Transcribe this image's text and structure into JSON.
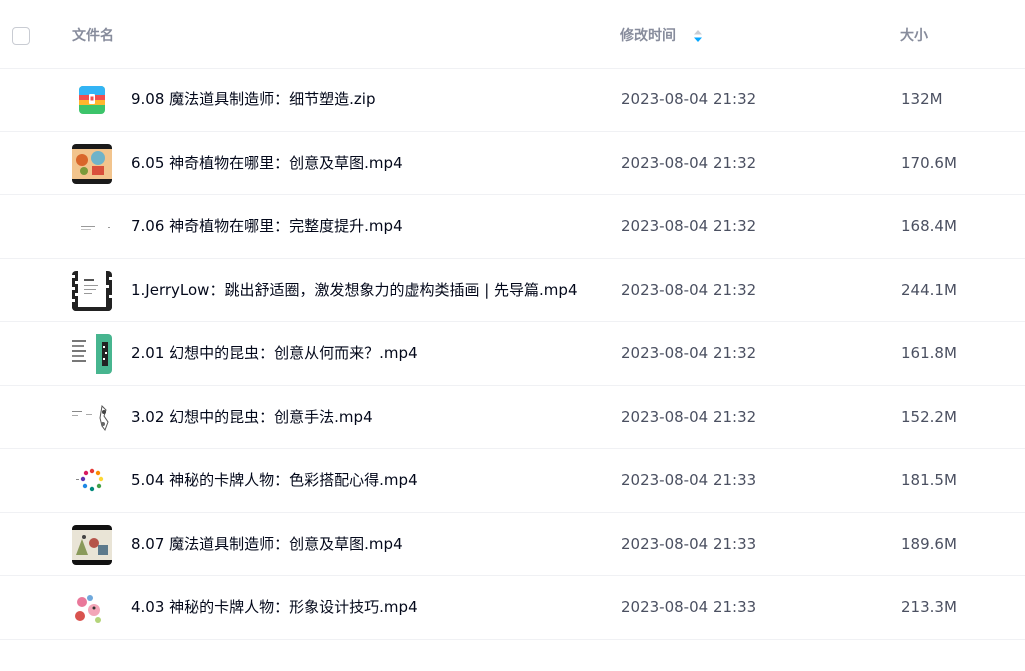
{
  "header": {
    "name_label": "文件名",
    "time_label": "修改时间",
    "size_label": "大小",
    "sort_icon": "sort-desc-icon",
    "sort_active_color": "#06a7ff"
  },
  "files": [
    {
      "name": "9.08 魔法道具制造师：细节塑造.zip",
      "time": "2023-08-04 21:32",
      "size": "132M",
      "icon": "zip-archive-icon"
    },
    {
      "name": "6.05 神奇植物在哪里：创意及草图.mp4",
      "time": "2023-08-04 21:32",
      "size": "170.6M",
      "icon": "video-thumbnail"
    },
    {
      "name": "7.06 神奇植物在哪里：完整度提升.mp4",
      "time": "2023-08-04 21:32",
      "size": "168.4M",
      "icon": "video-thumbnail"
    },
    {
      "name": "1.JerryLow：跳出舒适圈，激发想象力的虚构类插画 | 先导篇.mp4",
      "time": "2023-08-04 21:32",
      "size": "244.1M",
      "icon": "video-thumbnail"
    },
    {
      "name": "2.01 幻想中的昆虫：创意从何而来？.mp4",
      "time": "2023-08-04 21:32",
      "size": "161.8M",
      "icon": "video-thumbnail"
    },
    {
      "name": "3.02 幻想中的昆虫：创意手法.mp4",
      "time": "2023-08-04 21:32",
      "size": "152.2M",
      "icon": "video-thumbnail"
    },
    {
      "name": "5.04 神秘的卡牌人物：色彩搭配心得.mp4",
      "time": "2023-08-04 21:33",
      "size": "181.5M",
      "icon": "video-thumbnail"
    },
    {
      "name": "8.07 魔法道具制造师：创意及草图.mp4",
      "time": "2023-08-04 21:33",
      "size": "189.6M",
      "icon": "video-thumbnail"
    },
    {
      "name": "4.03 神秘的卡牌人物：形象设计技巧.mp4",
      "time": "2023-08-04 21:33",
      "size": "213.3M",
      "icon": "video-thumbnail"
    }
  ]
}
